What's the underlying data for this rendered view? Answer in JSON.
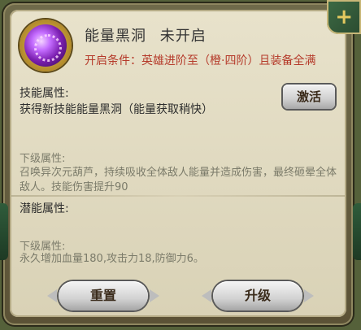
{
  "skill": {
    "name_label": "能量黑洞",
    "status_label": "未开启",
    "unlock_condition": "开启条件：英雄进阶至（橙·四阶）且装备全满"
  },
  "skill_attr": {
    "header": "技能属性:",
    "value": "获得新技能能量黑洞（能量获取稍快）",
    "activate_button": "激活",
    "sub_header": "下级属性:",
    "sub_value": "召唤异次元葫芦，持续吸收全体敌人能量并造成伤害，最终砸晕全体敌人。技能伤害提升90"
  },
  "potential_attr": {
    "header": "潜能属性:",
    "sub_header": "下级属性:",
    "sub_value": "永久增加血量180,攻击力18,防御力6。"
  },
  "buttons": {
    "reset": "重置",
    "upgrade": "升级"
  },
  "icons": {
    "corner": "plus-icon",
    "skill": "black-hole-orb-icon"
  }
}
